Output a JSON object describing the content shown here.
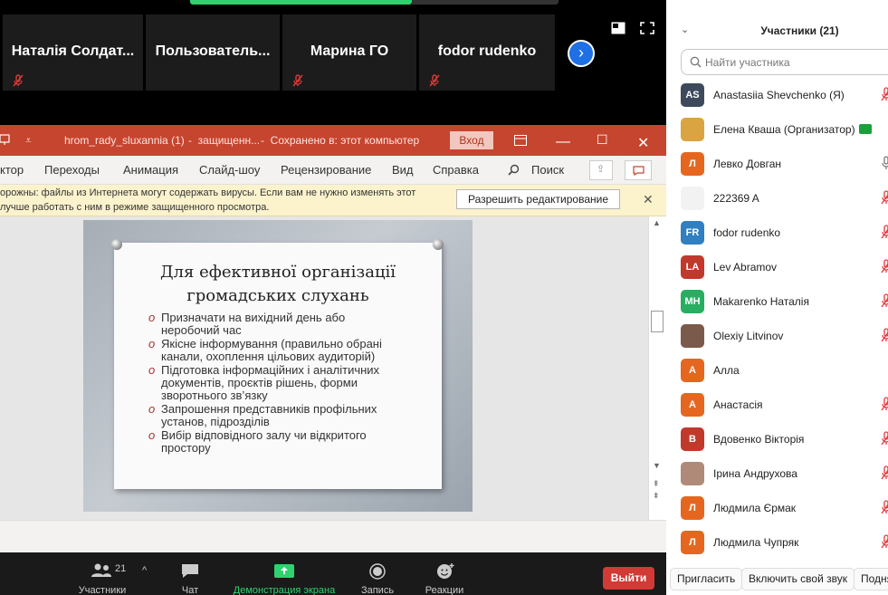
{
  "gallery": {
    "thumbnails": [
      {
        "name": "Наталія Солдат..."
      },
      {
        "name": "Пользователь..."
      },
      {
        "name": "Марина ГО"
      },
      {
        "name": "fodor rudenko"
      }
    ],
    "next_icon": "chevron-right-icon"
  },
  "ppt": {
    "file_name": "hrom_rady_sluxannia (1)",
    "mode": "защищенн...",
    "saved_status": "Сохранено в: этот компьютер",
    "login_label": "Вход",
    "menu": [
      "ктор",
      "Переходы",
      "Анимация",
      "Слайд-шоу",
      "Рецензирование",
      "Вид",
      "Справка",
      "Поиск"
    ],
    "warning_line1": "орожны: файлы из Интернета могут содержать вирусы. Если вам не нужно изменять этот",
    "warning_line2": "лучше работать с ним в режиме защищенного просмотра.",
    "enable_editing_label": "Разрешить редактирование",
    "slide": {
      "title_line1": "Для ефективної організації",
      "title_line2": "громадських слухань",
      "bullets": [
        {
          "line1": "Призначати на вихідний день або",
          "line2": "неробочий час",
          "line3": ""
        },
        {
          "line1": "Якісне інформування (правильно обрані",
          "line2": "канали, охоплення цільових аудиторій)",
          "line3": ""
        },
        {
          "line1": "Підготовка інформаційних і аналітичних",
          "line2": "документів, проєктів рішень, форми",
          "line3": "зворотнього зв’язку"
        },
        {
          "line1": "Запрошення представників профільних",
          "line2": "установ, підрозділів",
          "line3": ""
        },
        {
          "line1": "Вибір відповідного залу чи відкритого",
          "line2": "простору",
          "line3": ""
        }
      ]
    }
  },
  "toolbar": {
    "participants_count": "21",
    "participants_label": "Участники",
    "chat_label": "Чат",
    "share_label": "Демонстрация экрана",
    "record_label": "Запись",
    "reactions_label": "Реакции",
    "leave_label": "Выйти"
  },
  "panel": {
    "title": "Участники (21)",
    "search_placeholder": "Найти участника",
    "participants": [
      {
        "initials": "AS",
        "name": "Anastasiia Shevchenko (Я)",
        "color": "#3d4a5c"
      },
      {
        "initials": "",
        "name": "Елена Кваша (Организатор)",
        "color": "#d9a441"
      },
      {
        "initials": "Л",
        "name": "Левко Довган",
        "color": "#e5671f"
      },
      {
        "initials": "",
        "name": "222369 A",
        "color": "#f2f2f2"
      },
      {
        "initials": "FR",
        "name": "fodor rudenko",
        "color": "#2f7fc1"
      },
      {
        "initials": "LA",
        "name": "Lev Abramov",
        "color": "#c0392b"
      },
      {
        "initials": "MH",
        "name": "Makarenko Наталія",
        "color": "#27ae60"
      },
      {
        "initials": "",
        "name": "Olexiy Litvinov",
        "color": "#7a5a4a"
      },
      {
        "initials": "А",
        "name": "Алла",
        "color": "#e5671f"
      },
      {
        "initials": "А",
        "name": "Анастасія",
        "color": "#e5671f"
      },
      {
        "initials": "В",
        "name": "Вдовенко Вікторія",
        "color": "#c0392b"
      },
      {
        "initials": "",
        "name": "Ірина Андрухова",
        "color": "#b08a78"
      },
      {
        "initials": "Л",
        "name": "Людмила Єрмак",
        "color": "#e5671f"
      },
      {
        "initials": "Л",
        "name": "Людмила Чупряк",
        "color": "#e5671f"
      }
    ],
    "invite_label": "Пригласить",
    "unmute_label": "Включить свой звук",
    "more_label": "Подня"
  },
  "colors": {
    "ppt_accent": "#c6452f",
    "zoom_blue": "#1f6fe5",
    "leave_red": "#d13a35",
    "share_green": "#2ed36e"
  }
}
